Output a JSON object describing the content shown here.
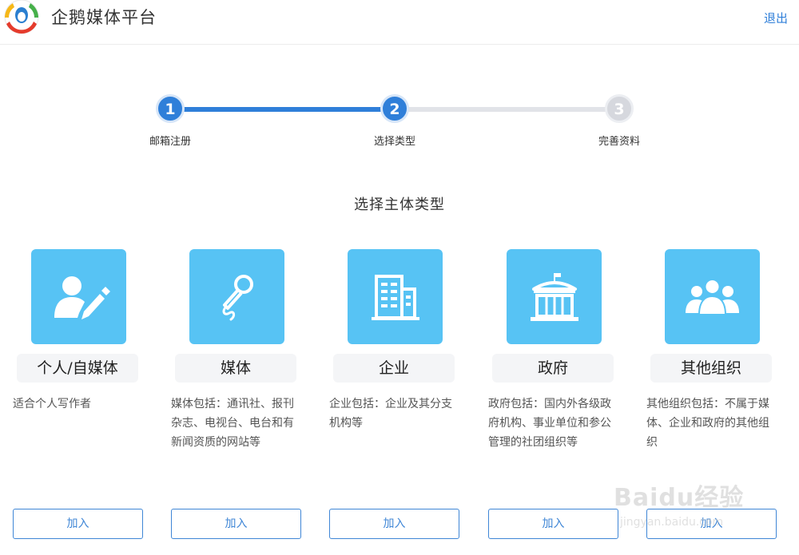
{
  "header": {
    "brand": "企鹅媒体平台",
    "logout": "退出",
    "logo_icon": "tencent-news-logo-icon"
  },
  "steps": [
    {
      "number": "1",
      "label": "邮箱注册",
      "state": "done"
    },
    {
      "number": "2",
      "label": "选择类型",
      "state": "active"
    },
    {
      "number": "3",
      "label": "完善资料",
      "state": "todo"
    }
  ],
  "section_title": "选择主体类型",
  "cards": [
    {
      "icon": "person-pen-icon",
      "title": "个人/自媒体",
      "desc": "适合个人写作者",
      "button": "加入"
    },
    {
      "icon": "microphone-icon",
      "title": "媒体",
      "desc": "媒体包括：通讯社、报刊杂志、电视台、电台和有新闻资质的网站等",
      "button": "加入"
    },
    {
      "icon": "building-icon",
      "title": "企业",
      "desc": "企业包括：企业及其分支机构等",
      "button": "加入"
    },
    {
      "icon": "government-building-icon",
      "title": "政府",
      "desc": "政府包括：国内外各级政府机构、事业单位和参公管理的社团组织等",
      "button": "加入"
    },
    {
      "icon": "group-icon",
      "title": "其他组织",
      "desc": "其他组织包括：不属于媒体、企业和政府的其他组织",
      "button": "加入"
    }
  ],
  "watermark": {
    "main": "Baidu经验",
    "sub": "jingyan.baidu.com"
  },
  "colors": {
    "accent": "#2f7fd9",
    "icon_bg": "#57c3f4",
    "inactive": "#d6d8de"
  }
}
